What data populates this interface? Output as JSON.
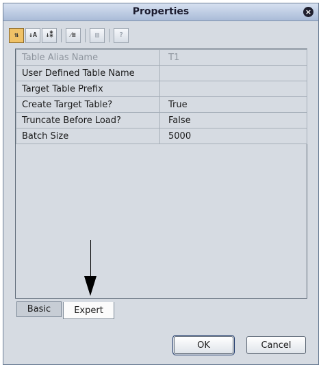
{
  "dialog": {
    "title": "Properties",
    "close_glyph": "×"
  },
  "toolbar": {
    "buttons": [
      {
        "icon": "categorized-view-icon",
        "glyph": "⇅"
      },
      {
        "icon": "sort-alphabetical-icon",
        "glyph": "↓A"
      },
      {
        "icon": "sort-by-category-icon",
        "glyph": "↓⁑"
      },
      {
        "icon": "show-changed-icon",
        "glyph": "⁄≡"
      },
      {
        "icon": "description-toggle-icon",
        "glyph": "▤"
      },
      {
        "icon": "help-icon",
        "glyph": "?"
      }
    ]
  },
  "properties": [
    {
      "name": "Table Alias Name",
      "value": "T1",
      "enabled": false
    },
    {
      "name": "User Defined Table Name",
      "value": "",
      "enabled": true
    },
    {
      "name": "Target Table Prefix",
      "value": "",
      "enabled": true
    },
    {
      "name": "Create Target Table?",
      "value": "True",
      "enabled": true
    },
    {
      "name": "Truncate Before Load?",
      "value": "False",
      "enabled": true
    },
    {
      "name": "Batch Size",
      "value": "5000",
      "enabled": true
    }
  ],
  "tabs": [
    {
      "label": "Basic",
      "selected": false
    },
    {
      "label": "Expert",
      "selected": true
    }
  ],
  "buttons": {
    "ok_label": "OK",
    "cancel_label": "Cancel"
  },
  "colors": {
    "active_toolbar": "#f0c267",
    "title_gradient_top": "#d7e1f1",
    "title_gradient_bottom": "#a9bbd8",
    "panel_bg": "#d6dbe2"
  }
}
